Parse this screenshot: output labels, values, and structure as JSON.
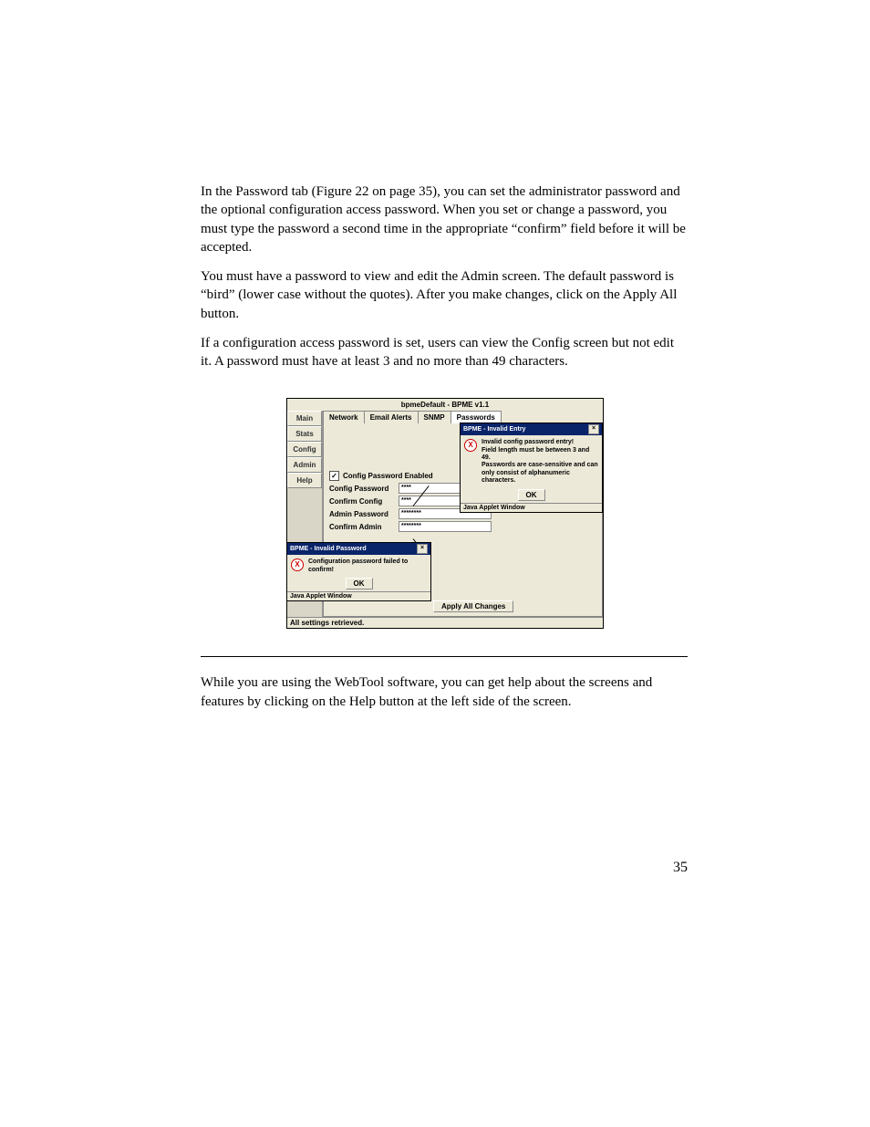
{
  "paragraphs": {
    "p1": "In the Password tab (Figure 22 on page 35), you can set the administrator pass­word and the optional configuration access password. When you set or change a password, you must type the password a second time in the appropriate “confirm” field before it will be accepted.",
    "p2": "You must have a password to view and edit the Admin screen. The default pass­word is “bird” (lower case without the quotes). After you make changes, click on the Apply All button.",
    "p3": "If a configuration access password is set, users can view the Config screen but not edit it. A password must have at least 3 and no more than 49 characters.",
    "p4": "While you are using the WebTool software, you can get help about the screens and features by clicking on the Help button at the left side of the screen."
  },
  "figure": {
    "title": "bpmeDefault - BPME v1.1",
    "sidebar": [
      "Main",
      "Stats",
      "Config",
      "Admin",
      "Help"
    ],
    "tabs": [
      "Network",
      "Email Alerts",
      "SNMP",
      "Passwords"
    ],
    "checkbox_label": "Config Password Enabled",
    "fields": {
      "config_pw": {
        "label": "Config Password",
        "value": "****"
      },
      "confirm_config": {
        "label": "Confirm Config",
        "value": "****"
      },
      "admin_pw": {
        "label": "Admin Password",
        "value": "********"
      },
      "confirm_admin": {
        "label": "Confirm Admin",
        "value": "********"
      }
    },
    "apply_button": "Apply All Changes",
    "status_line": "All settings retrieved.",
    "popup_invalid_entry": {
      "title": "BPME - Invalid Entry",
      "line1": "Invalid config password entry!",
      "line2": "Field length must be between 3 and 49.",
      "line3": "Passwords are case-sensitive and can only consist of alphanumeric characters.",
      "ok": "OK",
      "status": "Java Applet Window"
    },
    "popup_invalid_password": {
      "title": "BPME - Invalid Password",
      "msg": "Configuration password failed to confirm!",
      "ok": "OK",
      "status": "Java Applet Window"
    }
  },
  "page_number": "35"
}
